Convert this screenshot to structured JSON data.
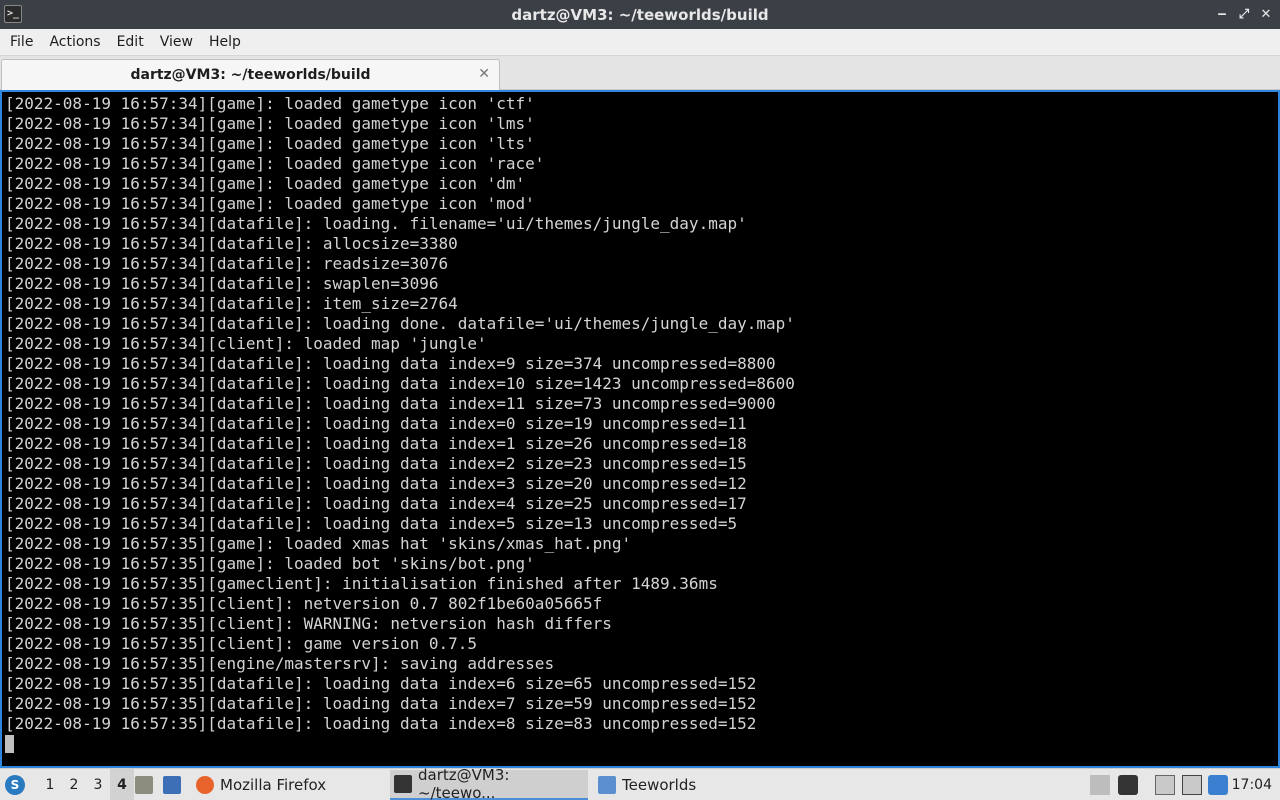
{
  "window": {
    "title": "dartz@VM3: ~/teeworlds/build",
    "app_icon": ">_",
    "controls": {
      "minimize": "‒",
      "maximize": "⤢",
      "close": "✕"
    }
  },
  "menu": [
    "File",
    "Actions",
    "Edit",
    "View",
    "Help"
  ],
  "tab": {
    "label": "dartz@VM3: ~/teeworlds/build",
    "close": "✕"
  },
  "terminal_lines": [
    "[2022-08-19 16:57:34][game]: loaded gametype icon 'ctf'",
    "[2022-08-19 16:57:34][game]: loaded gametype icon 'lms'",
    "[2022-08-19 16:57:34][game]: loaded gametype icon 'lts'",
    "[2022-08-19 16:57:34][game]: loaded gametype icon 'race'",
    "[2022-08-19 16:57:34][game]: loaded gametype icon 'dm'",
    "[2022-08-19 16:57:34][game]: loaded gametype icon 'mod'",
    "[2022-08-19 16:57:34][datafile]: loading. filename='ui/themes/jungle_day.map'",
    "[2022-08-19 16:57:34][datafile]: allocsize=3380",
    "[2022-08-19 16:57:34][datafile]: readsize=3076",
    "[2022-08-19 16:57:34][datafile]: swaplen=3096",
    "[2022-08-19 16:57:34][datafile]: item_size=2764",
    "[2022-08-19 16:57:34][datafile]: loading done. datafile='ui/themes/jungle_day.map'",
    "[2022-08-19 16:57:34][client]: loaded map 'jungle'",
    "[2022-08-19 16:57:34][datafile]: loading data index=9 size=374 uncompressed=8800",
    "[2022-08-19 16:57:34][datafile]: loading data index=10 size=1423 uncompressed=8600",
    "[2022-08-19 16:57:34][datafile]: loading data index=11 size=73 uncompressed=9000",
    "[2022-08-19 16:57:34][datafile]: loading data index=0 size=19 uncompressed=11",
    "[2022-08-19 16:57:34][datafile]: loading data index=1 size=26 uncompressed=18",
    "[2022-08-19 16:57:34][datafile]: loading data index=2 size=23 uncompressed=15",
    "[2022-08-19 16:57:34][datafile]: loading data index=3 size=20 uncompressed=12",
    "[2022-08-19 16:57:34][datafile]: loading data index=4 size=25 uncompressed=17",
    "[2022-08-19 16:57:34][datafile]: loading data index=5 size=13 uncompressed=5",
    "[2022-08-19 16:57:35][game]: loaded xmas hat 'skins/xmas_hat.png'",
    "[2022-08-19 16:57:35][game]: loaded bot 'skins/bot.png'",
    "[2022-08-19 16:57:35][gameclient]: initialisation finished after 1489.36ms",
    "[2022-08-19 16:57:35][client]: netversion 0.7 802f1be60a05665f",
    "[2022-08-19 16:57:35][client]: WARNING: netversion hash differs",
    "[2022-08-19 16:57:35][client]: game version 0.7.5",
    "[2022-08-19 16:57:35][engine/mastersrv]: saving addresses",
    "[2022-08-19 16:57:35][datafile]: loading data index=6 size=65 uncompressed=152",
    "[2022-08-19 16:57:35][datafile]: loading data index=7 size=59 uncompressed=152",
    "[2022-08-19 16:57:35][datafile]: loading data index=8 size=83 uncompressed=152"
  ],
  "taskbar": {
    "start_icon": "start-menu-icon",
    "workspaces": [
      "1",
      "2",
      "3",
      "4"
    ],
    "active_workspace": "4",
    "tasks": [
      {
        "label": "Mozilla Firefox",
        "icon": "firefox-icon",
        "color": "#e8632b"
      },
      {
        "label": "dartz@VM3: ~/teewo...",
        "icon": "terminal-icon",
        "color": "#333333"
      },
      {
        "label": "Teeworlds",
        "icon": "window-icon",
        "color": "#5b8fd0"
      }
    ],
    "clock": "17:04"
  },
  "colors": {
    "terminal_bg": "#000000",
    "terminal_fg": "#d4d4d4",
    "accent": "#2e86de"
  }
}
